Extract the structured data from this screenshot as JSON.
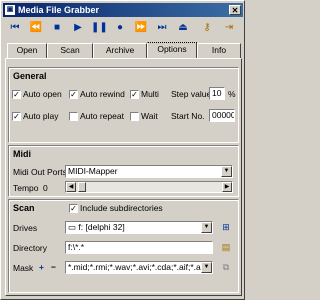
{
  "window": {
    "title": "Media File Grabber",
    "close_glyph": "✕",
    "app_icon": "film-icon"
  },
  "toolbar": {
    "icons": [
      "skip-start-icon",
      "rewind-icon",
      "stop-icon",
      "play-icon",
      "pause-icon",
      "record-icon",
      "forward-icon",
      "skip-end-icon",
      "eject-icon",
      "key-icon",
      "exit-icon"
    ]
  },
  "tabs": [
    "Open",
    "Scan",
    "Archive",
    "Options",
    "Info"
  ],
  "active_tab": "Options",
  "general": {
    "title": "General",
    "auto_open": "Auto open",
    "auto_rewind": "Auto rewind",
    "multi": "Multi",
    "auto_play": "Auto play",
    "auto_repeat": "Auto repeat",
    "wait": "Wait",
    "step_value_label": "Step value",
    "step_value": "10",
    "step_unit": "%",
    "start_no_label": "Start No.",
    "start_no": "00000",
    "checks": {
      "auto_open": true,
      "auto_rewind": true,
      "multi": true,
      "auto_play": true,
      "auto_repeat": false,
      "wait": false
    }
  },
  "midi": {
    "title": "Midi",
    "out_ports_label": "Midi Out Ports",
    "out_port": "MIDI-Mapper",
    "tempo_label": "Tempo",
    "tempo_value": "0"
  },
  "scan": {
    "title": "Scan",
    "include_sub": "Include subdirectories",
    "include_sub_checked": true,
    "drives_label": "Drives",
    "drive": "f: [delphi 32]",
    "directory_label": "Directory",
    "directory": "f:\\*.*",
    "mask_label": "Mask",
    "mask_add": "+",
    "mask_remove": "−",
    "mask": "*.mid;*.rmi;*.wav;*.avi;*.cda;*.aif;*.aiff;"
  }
}
